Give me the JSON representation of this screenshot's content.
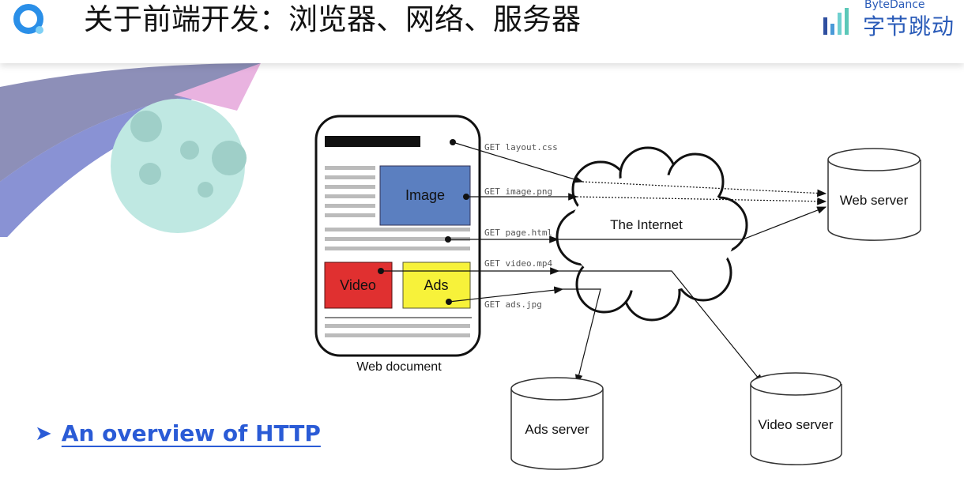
{
  "header": {
    "title": "关于前端开发：浏览器、网络、服务器",
    "brand_en": "ByteDance",
    "brand_cn": "字节跳动"
  },
  "diagram": {
    "web_document": "Web document",
    "image": "Image",
    "video": "Video",
    "ads": "Ads",
    "internet": "The Internet",
    "requests": [
      "GET layout.css",
      "GET image.png",
      "GET page.html",
      "GET video.mp4",
      "GET ads.jpg"
    ],
    "web_server": "Web server",
    "ads_server": "Ads server",
    "video_server": "Video server",
    "colors": {
      "image": "#5b7fc0",
      "video": "#e03030",
      "ads": "#f7f23a"
    }
  },
  "bullet": {
    "link": "An overview of HTTP"
  }
}
